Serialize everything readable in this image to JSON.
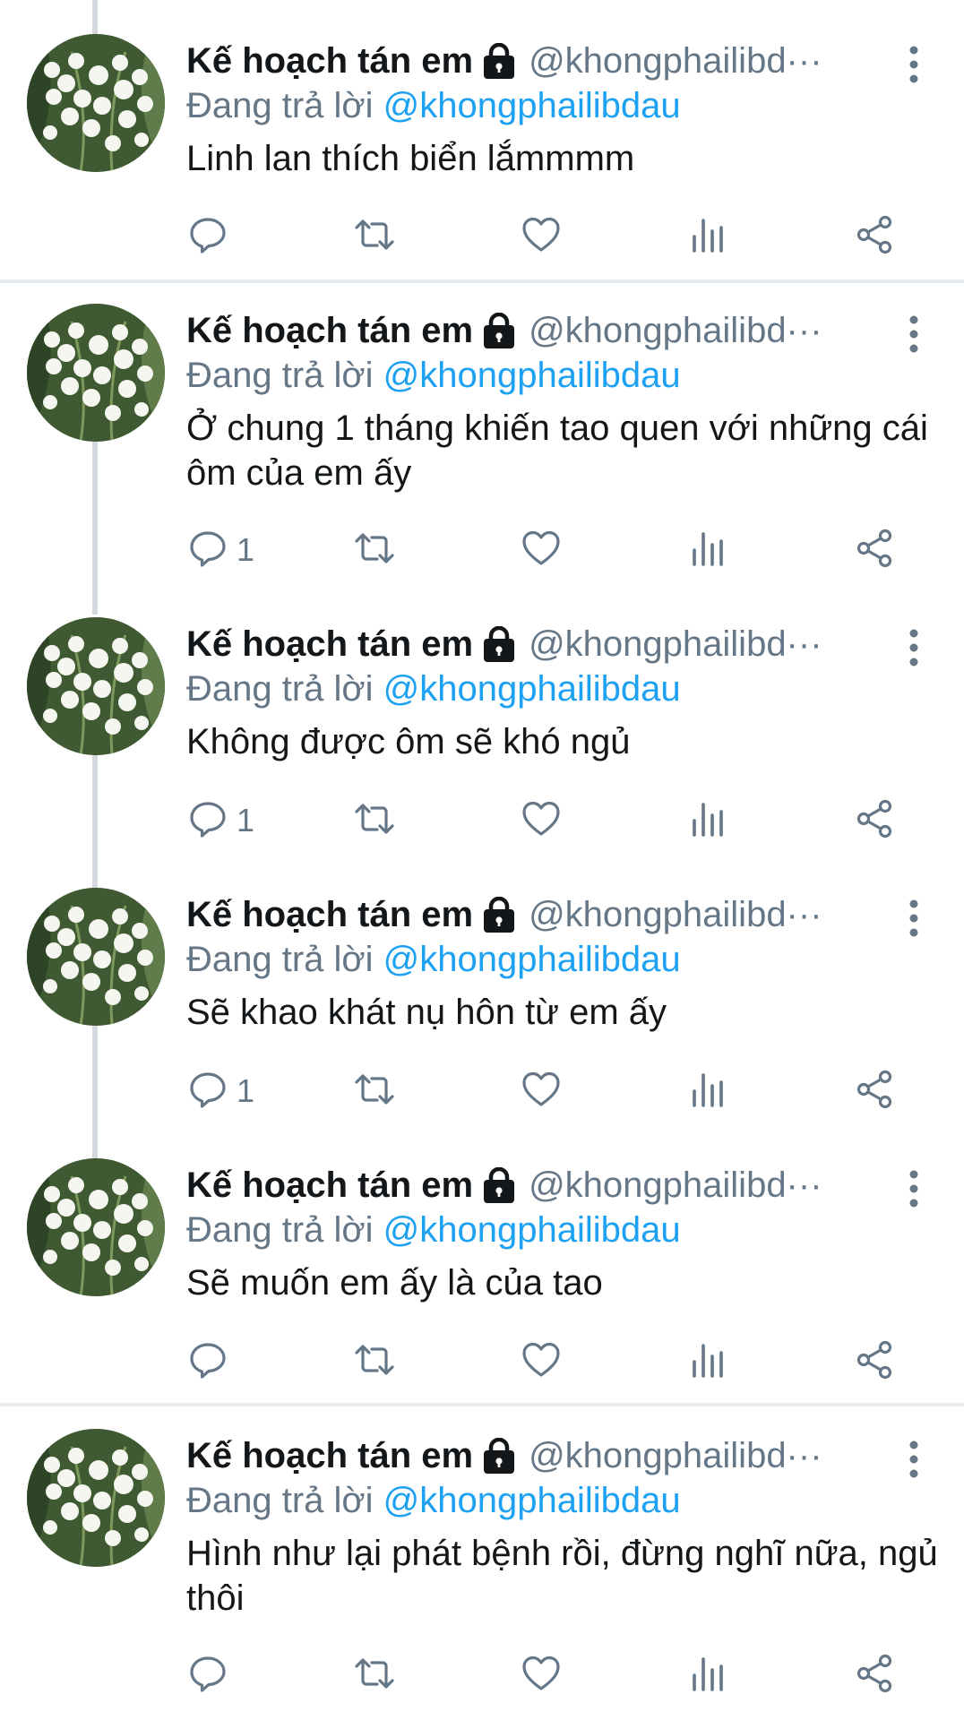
{
  "author": {
    "name": "Kế hoạch tán em",
    "handle": "@khongphailibd···"
  },
  "reply_prefix": "Đang trả lời",
  "reply_to": "@khongphailibdau",
  "colors": {
    "accent": "#1da1f2",
    "muted": "#657786",
    "text": "#14171a"
  },
  "icons": [
    "lock-icon",
    "more-vertical-icon",
    "reply-icon",
    "retweet-icon",
    "like-icon",
    "analytics-icon",
    "share-icon"
  ],
  "tweets": [
    {
      "text": "Linh lan thích biển lắmmmm",
      "reply_count": ""
    },
    {
      "text": "Ở chung 1 tháng khiến tao quen với những cái ôm của em ấy",
      "reply_count": "1"
    },
    {
      "text": "Không được ôm sẽ khó ngủ",
      "reply_count": "1"
    },
    {
      "text": "Sẽ khao khát nụ hôn từ em ấy",
      "reply_count": "1"
    },
    {
      "text": "Sẽ muốn em ấy là của tao",
      "reply_count": ""
    },
    {
      "text": "Hình như lại phát bệnh rồi, đừng nghĩ nữa, ngủ thôi",
      "reply_count": ""
    }
  ]
}
